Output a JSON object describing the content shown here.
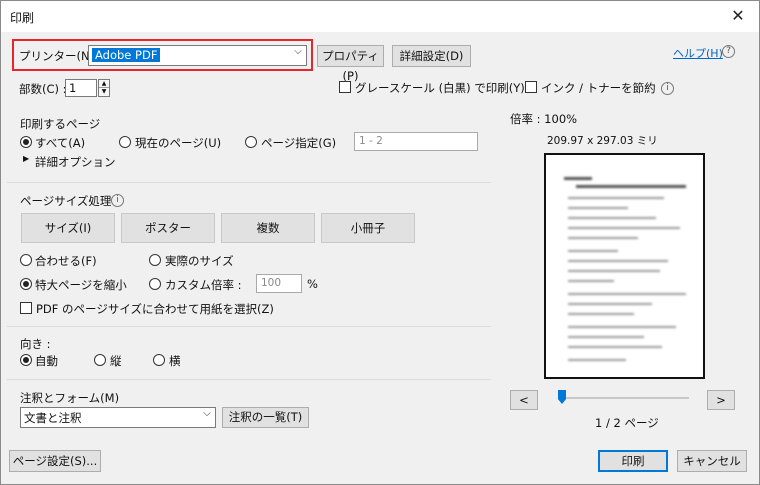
{
  "window": {
    "title": "印刷",
    "close_glyph": "✕"
  },
  "printer": {
    "label": "プリンター(N) :",
    "selected": "Adobe PDF",
    "properties_button": "プロパティ(P)",
    "advanced_button": "詳細設定(D)",
    "help_link": "ヘルプ(H)",
    "help_icon": "?"
  },
  "copies": {
    "label": "部数(C) :",
    "value": "1"
  },
  "options": {
    "grayscale": {
      "label": "グレースケール (白黒) で印刷(Y)",
      "checked": false
    },
    "save_ink": {
      "label": "インク / トナーを節約",
      "checked": false
    }
  },
  "pages": {
    "heading": "印刷するページ",
    "all": {
      "label": "すべて(A)",
      "selected": true
    },
    "current": {
      "label": "現在のページ(U)",
      "selected": false
    },
    "range": {
      "label": "ページ指定(G)",
      "selected": false,
      "placeholder": "1 - 2"
    },
    "more_options": "詳細オプション",
    "more_glyph": "▶"
  },
  "page_size": {
    "heading": "ページサイズ処理",
    "info_icon": "i",
    "buttons": [
      "サイズ(I)",
      "ポスター",
      "複数",
      "小冊子"
    ],
    "fit": {
      "label": "合わせる(F)",
      "selected": false
    },
    "actual": {
      "label": "実際のサイズ",
      "selected": false
    },
    "shrink": {
      "label": "特大ページを縮小",
      "selected": true
    },
    "custom": {
      "label": "カスタム倍率 :",
      "selected": false,
      "value": "100",
      "unit": "%"
    },
    "choose_paper": {
      "label": "PDF のページサイズに合わせて用紙を選択(Z)",
      "checked": false
    }
  },
  "orientation": {
    "heading": "向き :",
    "auto": {
      "label": "自動",
      "selected": true
    },
    "portrait": {
      "label": "縦",
      "selected": false
    },
    "landscape": {
      "label": "横",
      "selected": false
    }
  },
  "comments": {
    "heading": "注釈とフォーム(M)",
    "selected": "文書と注釈",
    "summary_button": "注釈の一覧(T)"
  },
  "preview": {
    "zoom": "倍率 : 100%",
    "dimensions": "209.97 x 297.03 ミリ",
    "prev": "<",
    "next": ">",
    "page_indicator": "1 / 2 ページ",
    "page_position": 0
  },
  "footer": {
    "page_setup": "ページ設定(S)...",
    "print": "印刷",
    "cancel": "キャンセル"
  },
  "icons": {
    "dropdown": "chevron-down-icon",
    "info": "info-icon",
    "help": "help-icon",
    "close": "close-icon"
  }
}
